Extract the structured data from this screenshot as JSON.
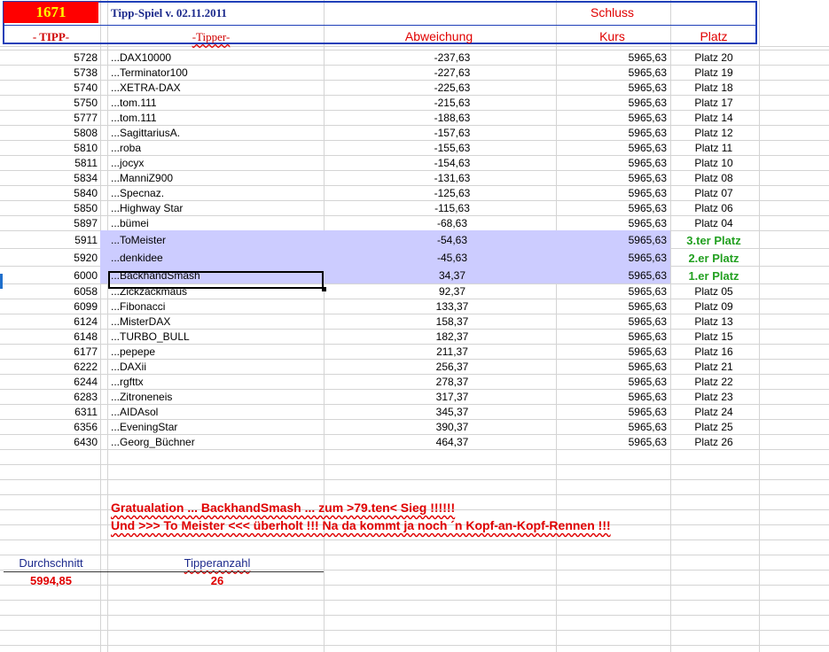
{
  "header": {
    "badge_number": "1671",
    "title": "Tipp-Spiel v. 02.11.2011",
    "schluss_label": "Schluss",
    "col_tipp": "- TIPP-",
    "col_tipper": "-Tipper-",
    "col_abweichung": "Abweichung",
    "col_kurs": "Kurs",
    "col_platz": "Platz"
  },
  "rows": [
    {
      "tipp": "5728",
      "name": "...DAX10000",
      "abw": "-237,63",
      "kurs": "5965,63",
      "platz": "Platz 20"
    },
    {
      "tipp": "5738",
      "name": "...Terminator100",
      "abw": "-227,63",
      "kurs": "5965,63",
      "platz": "Platz 19"
    },
    {
      "tipp": "5740",
      "name": "...XETRA-DAX",
      "abw": "-225,63",
      "kurs": "5965,63",
      "platz": "Platz 18"
    },
    {
      "tipp": "5750",
      "name": "...tom.111",
      "abw": "-215,63",
      "kurs": "5965,63",
      "platz": "Platz 17"
    },
    {
      "tipp": "5777",
      "name": "...tom.111",
      "abw": "-188,63",
      "kurs": "5965,63",
      "platz": "Platz 14"
    },
    {
      "tipp": "5808",
      "name": "...SagittariusA.",
      "abw": "-157,63",
      "kurs": "5965,63",
      "platz": "Platz 12"
    },
    {
      "tipp": "5810",
      "name": "...roba",
      "abw": "-155,63",
      "kurs": "5965,63",
      "platz": "Platz 11"
    },
    {
      "tipp": "5811",
      "name": "...jocyx",
      "abw": "-154,63",
      "kurs": "5965,63",
      "platz": "Platz 10"
    },
    {
      "tipp": "5834",
      "name": "...ManniZ900",
      "abw": "-131,63",
      "kurs": "5965,63",
      "platz": "Platz 08"
    },
    {
      "tipp": "5840",
      "name": "...Specnaz.",
      "abw": "-125,63",
      "kurs": "5965,63",
      "platz": "Platz 07"
    },
    {
      "tipp": "5850",
      "name": "...Highway Star",
      "abw": "-115,63",
      "kurs": "5965,63",
      "platz": "Platz 06"
    },
    {
      "tipp": "5897",
      "name": "...bümei",
      "abw": "-68,63",
      "kurs": "5965,63",
      "platz": "Platz 04"
    },
    {
      "tipp": "5911",
      "name": "...ToMeister",
      "abw": "-54,63",
      "kurs": "5965,63",
      "platz": "3.ter Platz",
      "winner": true
    },
    {
      "tipp": "5920",
      "name": "...denkidee",
      "abw": "-45,63",
      "kurs": "5965,63",
      "platz": "2.er Platz",
      "winner": true
    },
    {
      "tipp": "6000",
      "name": "...BackhandSmash",
      "abw": "34,37",
      "kurs": "5965,63",
      "platz": "1.er Platz",
      "winner": true
    },
    {
      "tipp": "6058",
      "name": "...Zickzackmaus",
      "abw": "92,37",
      "kurs": "5965,63",
      "platz": "Platz 05"
    },
    {
      "tipp": "6099",
      "name": "...Fibonacci",
      "abw": "133,37",
      "kurs": "5965,63",
      "platz": "Platz 09"
    },
    {
      "tipp": "6124",
      "name": "...MisterDAX",
      "abw": "158,37",
      "kurs": "5965,63",
      "platz": "Platz 13"
    },
    {
      "tipp": "6148",
      "name": "...TURBO_BULL",
      "abw": "182,37",
      "kurs": "5965,63",
      "platz": "Platz 15"
    },
    {
      "tipp": "6177",
      "name": "...pepepe",
      "abw": "211,37",
      "kurs": "5965,63",
      "platz": "Platz 16"
    },
    {
      "tipp": "6222",
      "name": "...DAXii",
      "abw": "256,37",
      "kurs": "5965,63",
      "platz": "Platz 21"
    },
    {
      "tipp": "6244",
      "name": "...rgfttx",
      "abw": "278,37",
      "kurs": "5965,63",
      "platz": "Platz 22"
    },
    {
      "tipp": "6283",
      "name": "...Zitroneneis",
      "abw": "317,37",
      "kurs": "5965,63",
      "platz": "Platz 23"
    },
    {
      "tipp": "6311",
      "name": "...AIDAsol",
      "abw": "345,37",
      "kurs": "5965,63",
      "platz": "Platz 24"
    },
    {
      "tipp": "6356",
      "name": "...EveningStar",
      "abw": "390,37",
      "kurs": "5965,63",
      "platz": "Platz 25"
    },
    {
      "tipp": "6430",
      "name": "...Georg_Büchner",
      "abw": "464,37",
      "kurs": "5965,63",
      "platz": "Platz 26"
    }
  ],
  "messages": {
    "line1": "Gratualation ... BackhandSmash ...  zum  >79.ten< Sieg !!!!!!",
    "line2": "Und  >>> To Meister <<< überholt !!! Na da kommt ja noch ´n Kopf-an-Kopf-Rennen !!!"
  },
  "summary": {
    "avg_label": "Durchschnitt",
    "avg_value": "5994,85",
    "count_label": "Tipperanzahl",
    "count_value": "26"
  },
  "colors": {
    "highlight": "#ccccff",
    "accent_red": "#e00000",
    "winner_green": "#22a020",
    "header_blue": "#1f3fb8"
  }
}
